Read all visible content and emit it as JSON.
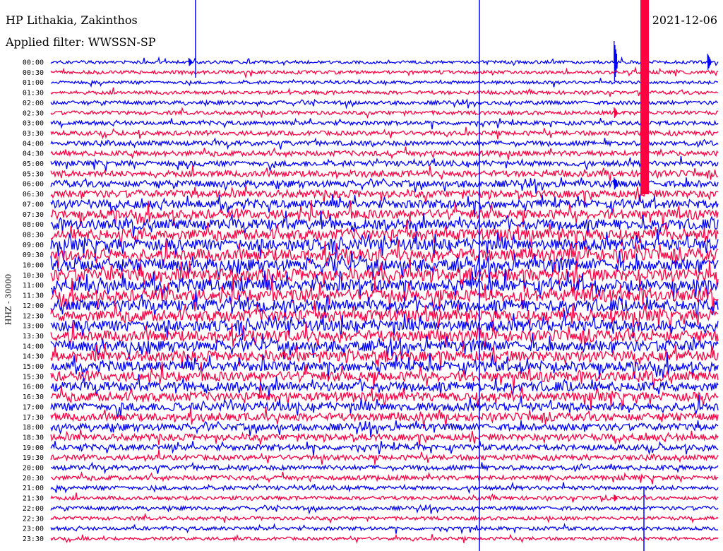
{
  "header": {
    "title": "HP Lithakia, Zakinthos",
    "filter": "Applied filter: WWSSN-SP",
    "date": "2021-12-06"
  },
  "chart_data": {
    "type": "line",
    "title": "HP Lithakia, Zakinthos",
    "subtitle": "Applied filter: WWSSN-SP",
    "date": "2021-12-06",
    "ylabel": "HHZ - 30000",
    "xlabel": "",
    "row_labels": [
      "00:00",
      "00:30",
      "01:00",
      "01:30",
      "02:00",
      "02:30",
      "03:00",
      "03:30",
      "04:00",
      "04:30",
      "05:00",
      "05:30",
      "06:00",
      "06:30",
      "07:00",
      "07:30",
      "08:00",
      "08:30",
      "09:00",
      "09:30",
      "10:00",
      "10:30",
      "11:00",
      "11:30",
      "12:00",
      "12:30",
      "13:00",
      "13:30",
      "14:00",
      "14:30",
      "15:00",
      "15:30",
      "16:00",
      "16:30",
      "17:00",
      "17:30",
      "18:00",
      "18:30",
      "19:00",
      "19:30",
      "20:00",
      "20:30",
      "21:00",
      "21:30",
      "22:00",
      "22:30",
      "23:00",
      "23:30"
    ],
    "row_noise_level": [
      1.0,
      1.1,
      1.0,
      1.1,
      1.2,
      1.2,
      1.3,
      1.4,
      1.5,
      1.6,
      1.7,
      1.9,
      2.1,
      2.3,
      2.6,
      2.9,
      3.2,
      3.4,
      3.6,
      3.7,
      3.8,
      3.8,
      3.8,
      3.7,
      3.6,
      3.6,
      3.5,
      3.4,
      3.3,
      3.2,
      3.1,
      3.0,
      2.9,
      2.8,
      2.6,
      2.4,
      2.2,
      2.0,
      1.8,
      1.6,
      1.5,
      1.4,
      1.3,
      1.2,
      1.2,
      1.1,
      1.1,
      1.0
    ],
    "events": [
      {
        "row": 0,
        "minute": 6.2,
        "amplitude": 6
      },
      {
        "row": 0,
        "minute": 29.5,
        "amplitude": 12
      },
      {
        "row": 0,
        "minute": 25.3,
        "amplitude": 30
      },
      {
        "row": 5,
        "minute": 25.3,
        "amplitude": 8
      },
      {
        "row": 12,
        "minute": 25.3,
        "amplitude": 9
      },
      {
        "row": 33,
        "minute": 9.3,
        "amplitude": 4
      },
      {
        "row": 43,
        "minute": 25.3,
        "amplitude": 5
      }
    ],
    "series": [
      {
        "name": "",
        "color": "#0000ff"
      },
      {
        "name": "",
        "color": "#ff0040"
      }
    ],
    "grid": false
  }
}
